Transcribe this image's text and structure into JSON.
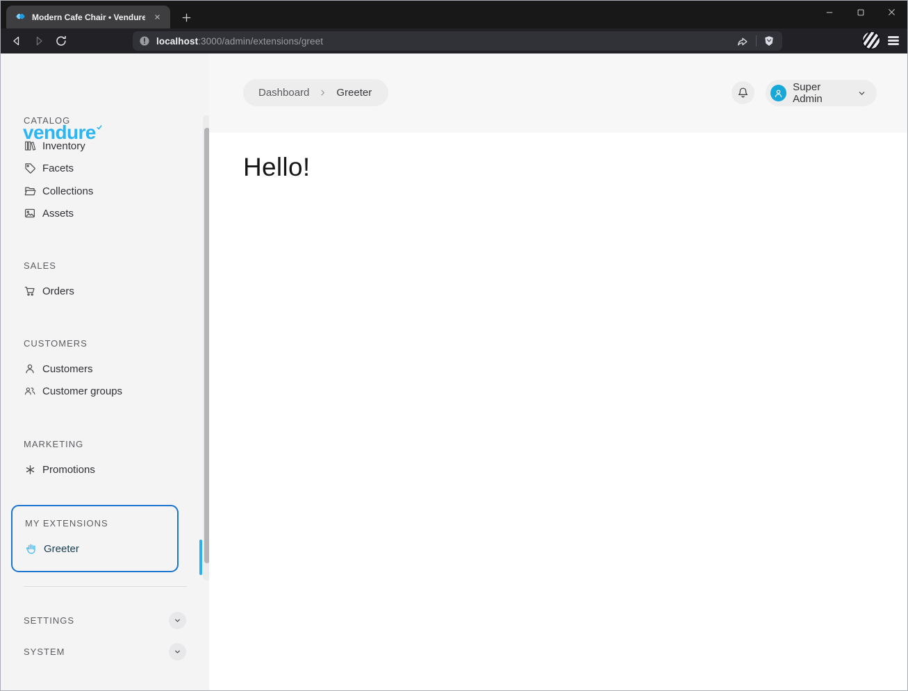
{
  "browser": {
    "tab_title": "Modern Cafe Chair • Vendure",
    "url_host": "localhost",
    "url_path": ":3000/admin/extensions/greet"
  },
  "sidebar": {
    "logo_text": "vendure",
    "sections": [
      {
        "label": "CATALOG",
        "items": [
          {
            "label": "Inventory",
            "icon": "library-icon"
          },
          {
            "label": "Facets",
            "icon": "tag-icon"
          },
          {
            "label": "Collections",
            "icon": "folder-icon"
          },
          {
            "label": "Assets",
            "icon": "image-icon"
          }
        ]
      },
      {
        "label": "SALES",
        "items": [
          {
            "label": "Orders",
            "icon": "cart-icon"
          }
        ]
      },
      {
        "label": "CUSTOMERS",
        "items": [
          {
            "label": "Customers",
            "icon": "user-icon"
          },
          {
            "label": "Customer groups",
            "icon": "users-icon"
          }
        ]
      },
      {
        "label": "MARKETING",
        "items": [
          {
            "label": "Promotions",
            "icon": "asterisk-icon"
          }
        ]
      },
      {
        "label": "MY EXTENSIONS",
        "items": [
          {
            "label": "Greeter",
            "icon": "hand-icon",
            "active": true
          }
        ]
      }
    ],
    "footer_sections": [
      {
        "label": "SETTINGS"
      },
      {
        "label": "SYSTEM"
      }
    ]
  },
  "header": {
    "breadcrumb_root": "Dashboard",
    "breadcrumb_current": "Greeter",
    "user_name": "Super Admin"
  },
  "content": {
    "greeting": "Hello!"
  },
  "colors": {
    "brand_blue": "#2ab5f4",
    "extension_highlight_border": "#1a74d0",
    "active_indicator": "#29b2ef",
    "user_avatar_bg": "#17a8da"
  }
}
